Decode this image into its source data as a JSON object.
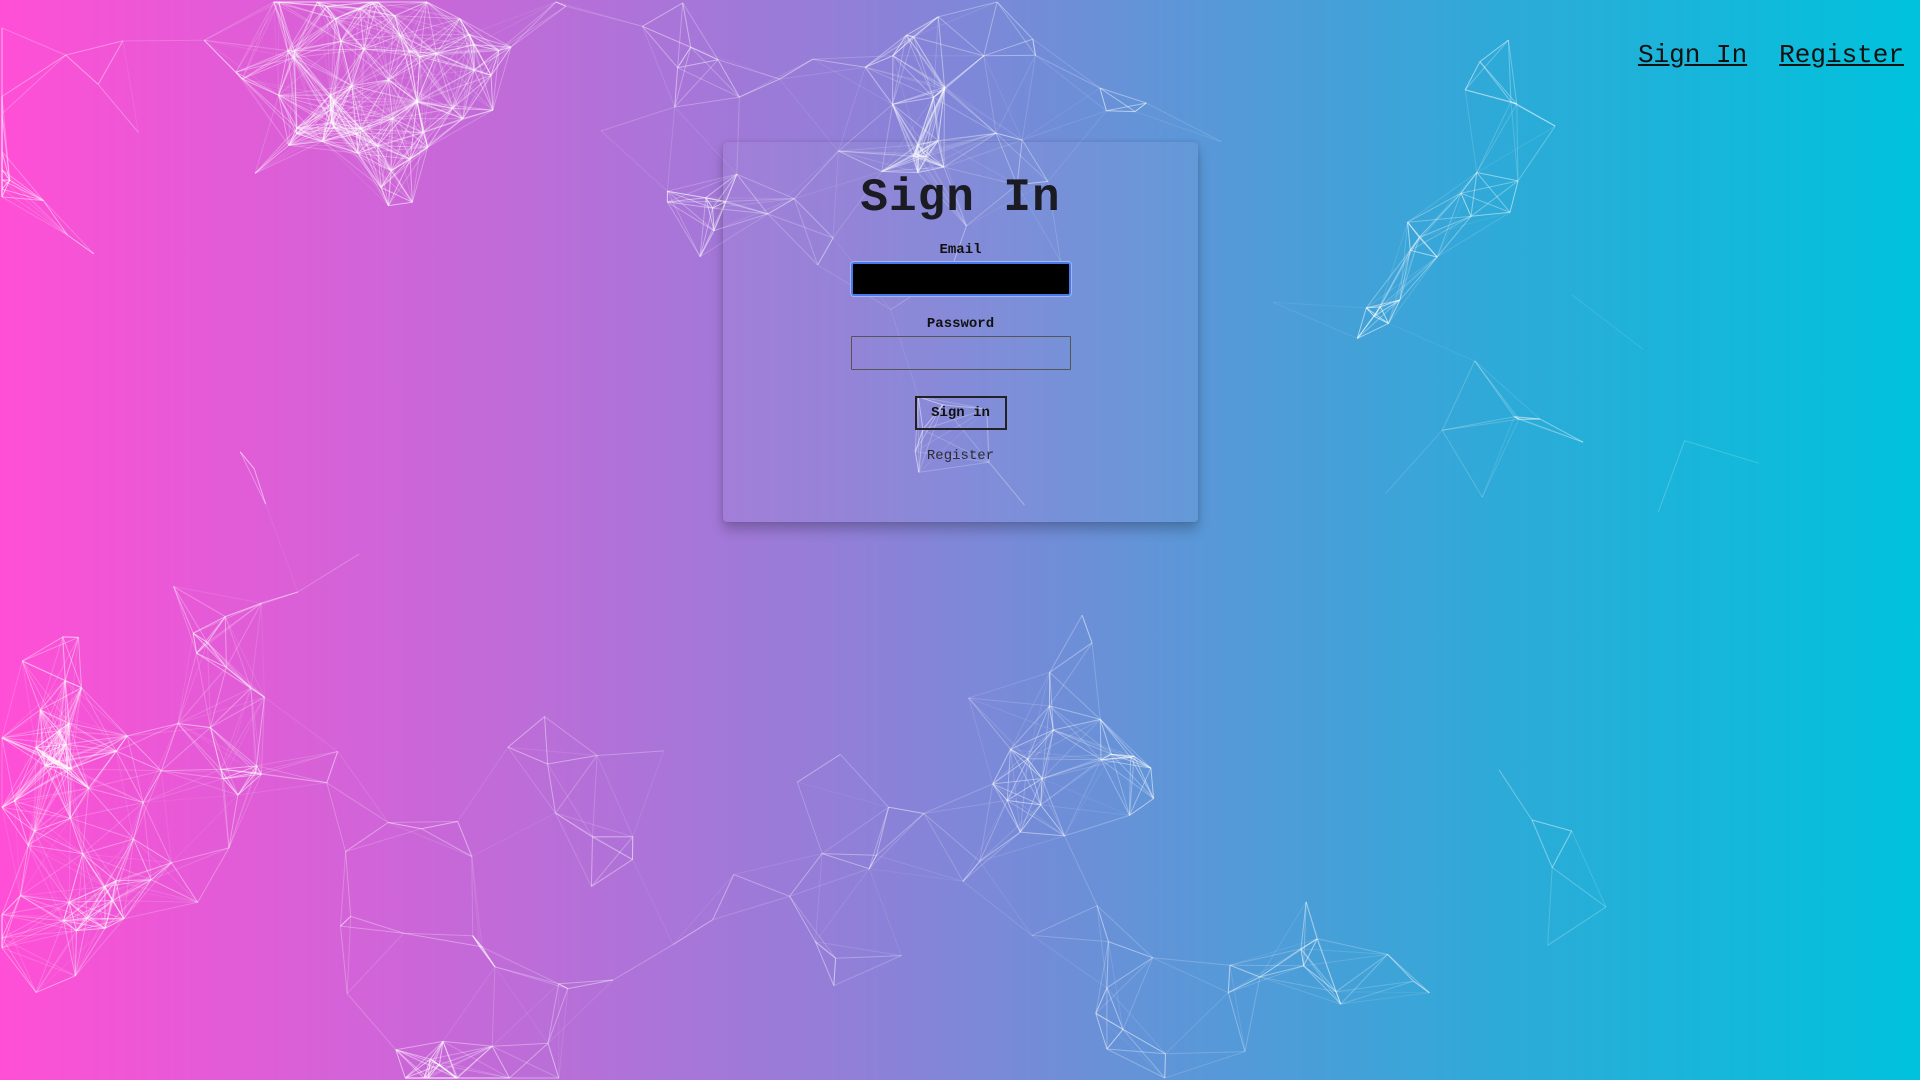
{
  "nav": {
    "sign_in": "Sign In",
    "register": "Register"
  },
  "form": {
    "title": "Sign In",
    "email_label": "Email",
    "email_value": "",
    "password_label": "Password",
    "password_value": "",
    "submit_label": "Sign in",
    "register_link": "Register"
  },
  "colors": {
    "gradient_start": "#ff4fd6",
    "gradient_end": "#00c2dc",
    "focus_border": "#4a78e8"
  }
}
